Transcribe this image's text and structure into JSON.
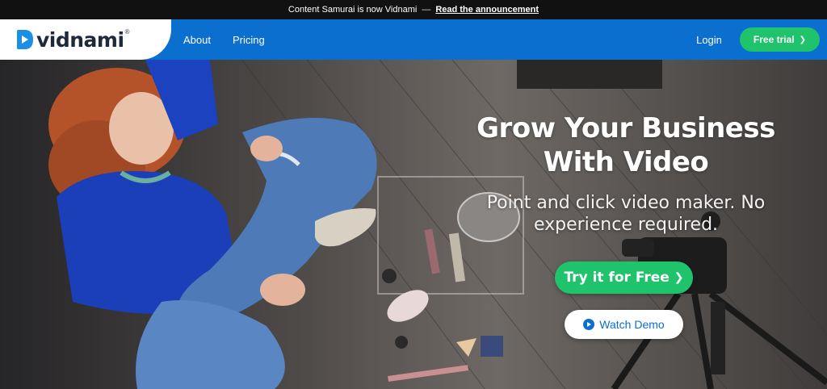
{
  "announcement": {
    "text": "Content Samurai is now Vidnami",
    "separator": "—",
    "link_label": "Read the announcement"
  },
  "header": {
    "logo_text": "vidnami",
    "logo_reg": "®",
    "nav": [
      "About",
      "Pricing"
    ],
    "login_label": "Login",
    "trial_label": "Free trial",
    "trial_chevron": "❯"
  },
  "hero": {
    "title_line1": "Grow Your Business",
    "title_line2": "With Video",
    "subtitle_line1": "Point and click video maker. No",
    "subtitle_line2": "experience required.",
    "try_label": "Try it for Free",
    "try_chevron": "❯",
    "demo_label": "Watch Demo"
  },
  "colors": {
    "brand_blue": "#0b6fcf",
    "accent_green": "#1fc36b",
    "announce_bg": "#111111"
  },
  "icons": [
    "vidnami-logo-icon",
    "chevron-right-icon",
    "play-icon"
  ]
}
